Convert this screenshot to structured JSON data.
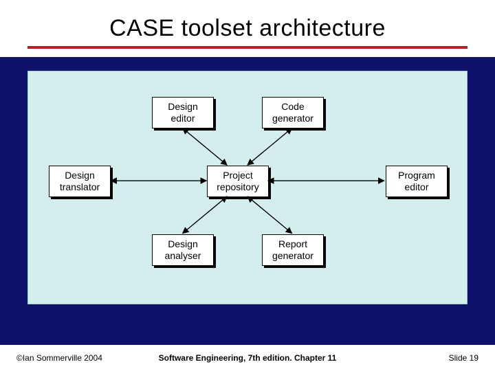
{
  "title": "CASE toolset architecture",
  "nodes": {
    "design_editor": "Design\neditor",
    "code_generator": "Code\ngenerator",
    "design_translator": "Design\ntranslator",
    "project_repository": "Project\nrepository",
    "program_editor": "Program\neditor",
    "design_analyser": "Design\nanalyser",
    "report_generator": "Report\ngenerator"
  },
  "footer": {
    "copyright": "©Ian Sommerville 2004",
    "book": "Software Engineering, 7th edition. Chapter 11",
    "slide": "Slide 19"
  }
}
